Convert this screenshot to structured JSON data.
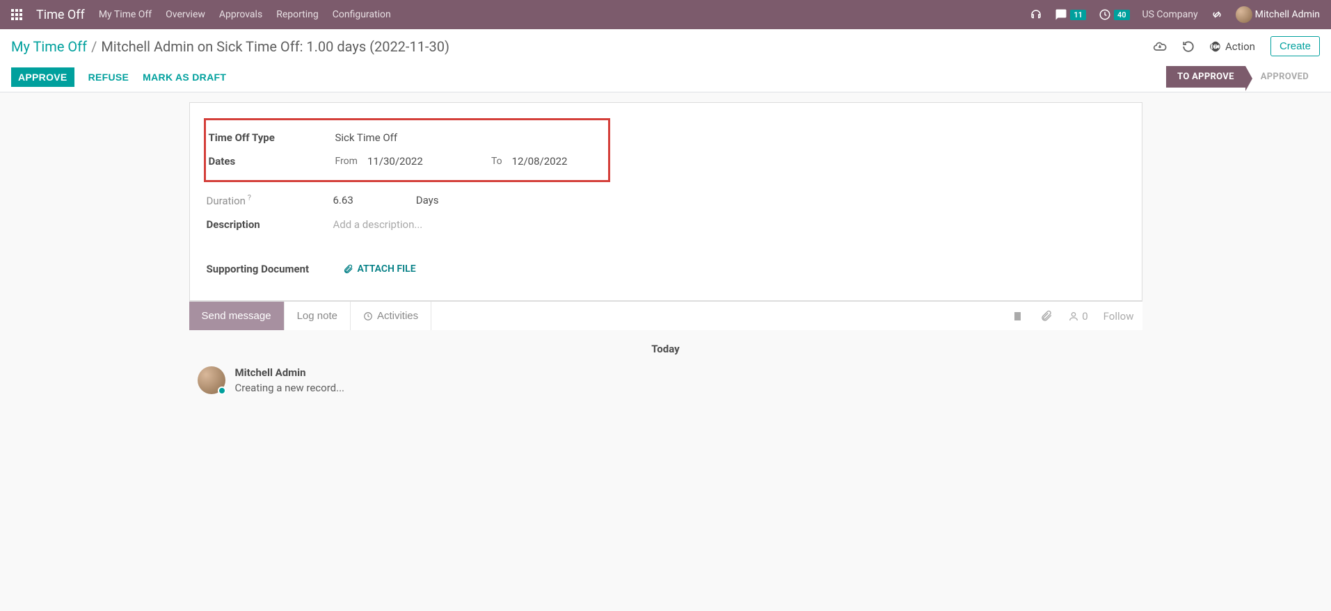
{
  "navbar": {
    "brand": "Time Off",
    "menu": [
      "My Time Off",
      "Overview",
      "Approvals",
      "Reporting",
      "Configuration"
    ],
    "msg_count": "11",
    "clock_count": "40",
    "company": "US Company",
    "user": "Mitchell Admin"
  },
  "breadcrumb": {
    "parent": "My Time Off",
    "current": "Mitchell Admin on Sick Time Off: 1.00 days (2022-11-30)"
  },
  "toolbar": {
    "action": "Action",
    "create": "Create"
  },
  "workflow": {
    "approve": "APPROVE",
    "refuse": "REFUSE",
    "mark_draft": "MARK AS DRAFT",
    "status_to_approve": "TO APPROVE",
    "status_approved": "APPROVED"
  },
  "form": {
    "type_label": "Time Off Type",
    "type_value": "Sick Time Off",
    "dates_label": "Dates",
    "from_label": "From",
    "from_value": "11/30/2022",
    "to_label": "To",
    "to_value": "12/08/2022",
    "duration_label": "Duration",
    "duration_value": "6.63",
    "duration_unit": "Days",
    "description_label": "Description",
    "description_placeholder": "Add a description...",
    "supporting_label": "Supporting Document",
    "attach_label": "ATTACH FILE"
  },
  "chatter": {
    "send": "Send message",
    "log": "Log note",
    "activities": "Activities",
    "followers": "0",
    "follow": "Follow",
    "today": "Today",
    "msg_author": "Mitchell Admin",
    "msg_body": "Creating a new record..."
  }
}
